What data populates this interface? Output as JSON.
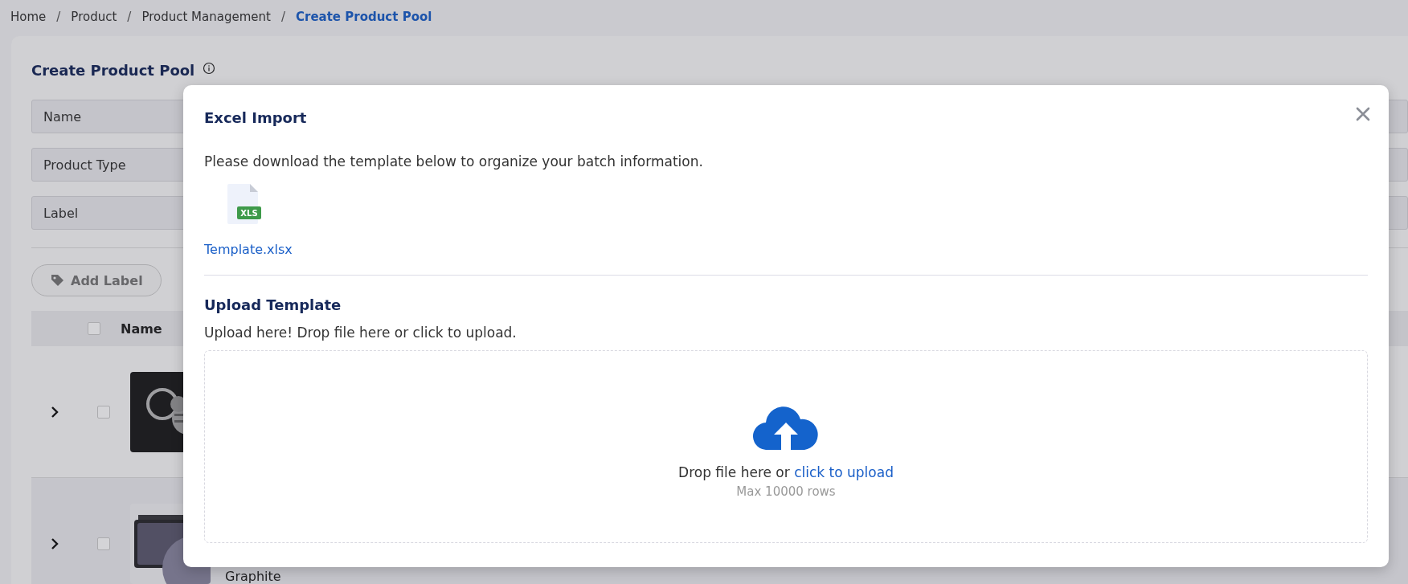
{
  "breadcrumb": [
    {
      "label": "Home",
      "current": false
    },
    {
      "separator": "/",
      "label": "Product",
      "current": false
    },
    {
      "separator": "/",
      "label": "Product Management",
      "current": false
    },
    {
      "separator": "/",
      "label": "Create Product Pool",
      "current": true
    }
  ],
  "page": {
    "title": "Create Product Pool",
    "filters": [
      {
        "label": "Name"
      },
      {
        "label": "Product Type"
      },
      {
        "label": "Label"
      }
    ],
    "actions": [
      {
        "label": "Add Label"
      }
    ]
  },
  "table": {
    "header_checked": false,
    "columns": [
      {
        "label": "Name"
      }
    ],
    "rows": [
      {
        "expanded": false,
        "checked": false,
        "kind": "picture"
      },
      {
        "expanded": false,
        "checked": false,
        "kind": "picture",
        "name": "Graphite"
      }
    ]
  },
  "modal": {
    "title": "Excel Import",
    "description": "Please download the template below to organize your batch information.",
    "file": {
      "badge": "XLS",
      "name": "Template.xlsx"
    },
    "upload_title": "Upload Template",
    "upload_hint": "Upload here! Drop file here or click to upload.",
    "dropzone": {
      "text": "Drop file here or ",
      "link": "click to upload",
      "note": "Max 10000 rows"
    }
  }
}
